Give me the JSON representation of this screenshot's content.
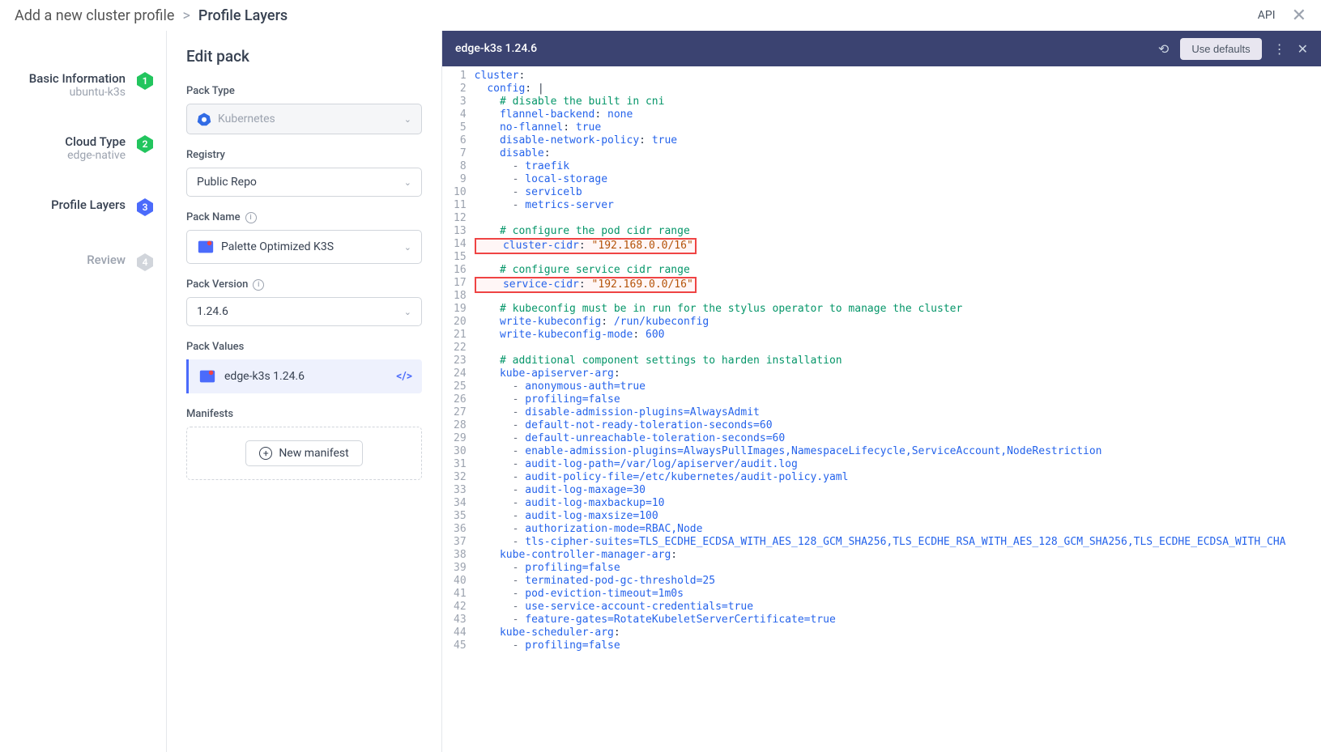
{
  "breadcrumb": {
    "root": "Add a new cluster profile",
    "sep": ">",
    "current": "Profile Layers"
  },
  "topbar": {
    "api": "API"
  },
  "steps": [
    {
      "title": "Basic Information",
      "sub": "ubuntu-k3s",
      "num": "1",
      "color": "#22c55e"
    },
    {
      "title": "Cloud Type",
      "sub": "edge-native",
      "num": "2",
      "color": "#22c55e"
    },
    {
      "title": "Profile Layers",
      "sub": "",
      "num": "3",
      "color": "#4b6bfb"
    },
    {
      "title": "Review",
      "sub": "",
      "num": "4",
      "color": "#d1d5db"
    }
  ],
  "form": {
    "title": "Edit pack",
    "labels": {
      "packType": "Pack Type",
      "registry": "Registry",
      "packName": "Pack Name",
      "packVersion": "Pack Version",
      "packValues": "Pack Values",
      "manifests": "Manifests"
    },
    "values": {
      "packType": "Kubernetes",
      "registry": "Public Repo",
      "packName": "Palette Optimized K3S",
      "packVersion": "1.24.6",
      "packValueItem": "edge-k3s 1.24.6"
    },
    "newManifest": "New manifest"
  },
  "editor": {
    "title": "edge-k3s 1.24.6",
    "defaultsBtn": "Use defaults",
    "lines": [
      [
        {
          "t": "key",
          "v": "cluster"
        },
        {
          "t": "p",
          "v": ":"
        }
      ],
      [
        {
          "t": "p",
          "v": "  "
        },
        {
          "t": "key",
          "v": "config"
        },
        {
          "t": "p",
          "v": ": |"
        }
      ],
      [
        {
          "t": "p",
          "v": "    "
        },
        {
          "t": "comment",
          "v": "# disable the built in cni"
        }
      ],
      [
        {
          "t": "p",
          "v": "    "
        },
        {
          "t": "key",
          "v": "flannel-backend"
        },
        {
          "t": "p",
          "v": ": "
        },
        {
          "t": "key",
          "v": "none"
        }
      ],
      [
        {
          "t": "p",
          "v": "    "
        },
        {
          "t": "key",
          "v": "no-flannel"
        },
        {
          "t": "p",
          "v": ": "
        },
        {
          "t": "key",
          "v": "true"
        }
      ],
      [
        {
          "t": "p",
          "v": "    "
        },
        {
          "t": "key",
          "v": "disable-network-policy"
        },
        {
          "t": "p",
          "v": ": "
        },
        {
          "t": "key",
          "v": "true"
        }
      ],
      [
        {
          "t": "p",
          "v": "    "
        },
        {
          "t": "key",
          "v": "disable"
        },
        {
          "t": "p",
          "v": ":"
        }
      ],
      [
        {
          "t": "p",
          "v": "      "
        },
        {
          "t": "dash",
          "v": "-"
        },
        {
          "t": "p",
          "v": " "
        },
        {
          "t": "key",
          "v": "traefik"
        }
      ],
      [
        {
          "t": "p",
          "v": "      "
        },
        {
          "t": "dash",
          "v": "-"
        },
        {
          "t": "p",
          "v": " "
        },
        {
          "t": "key",
          "v": "local-storage"
        }
      ],
      [
        {
          "t": "p",
          "v": "      "
        },
        {
          "t": "dash",
          "v": "-"
        },
        {
          "t": "p",
          "v": " "
        },
        {
          "t": "key",
          "v": "servicelb"
        }
      ],
      [
        {
          "t": "p",
          "v": "      "
        },
        {
          "t": "dash",
          "v": "-"
        },
        {
          "t": "p",
          "v": " "
        },
        {
          "t": "key",
          "v": "metrics-server"
        }
      ],
      [],
      [
        {
          "t": "p",
          "v": "    "
        },
        {
          "t": "comment",
          "v": "# configure the pod cidr range"
        }
      ],
      [
        {
          "t": "hlstart",
          "v": ""
        },
        {
          "t": "p",
          "v": "    "
        },
        {
          "t": "key",
          "v": "cluster-cidr"
        },
        {
          "t": "p",
          "v": ": "
        },
        {
          "t": "str",
          "v": "\"192.168.0.0/16\""
        },
        {
          "t": "hlend",
          "v": ""
        }
      ],
      [],
      [
        {
          "t": "p",
          "v": "    "
        },
        {
          "t": "comment",
          "v": "# configure service cidr range"
        }
      ],
      [
        {
          "t": "hlstart",
          "v": ""
        },
        {
          "t": "p",
          "v": "    "
        },
        {
          "t": "key",
          "v": "service-cidr"
        },
        {
          "t": "p",
          "v": ": "
        },
        {
          "t": "str",
          "v": "\"192.169.0.0/16\""
        },
        {
          "t": "hlend",
          "v": ""
        }
      ],
      [],
      [
        {
          "t": "p",
          "v": "    "
        },
        {
          "t": "comment",
          "v": "# kubeconfig must be in run for the stylus operator to manage the cluster"
        }
      ],
      [
        {
          "t": "p",
          "v": "    "
        },
        {
          "t": "key",
          "v": "write-kubeconfig"
        },
        {
          "t": "p",
          "v": ": "
        },
        {
          "t": "key",
          "v": "/run/kubeconfig"
        }
      ],
      [
        {
          "t": "p",
          "v": "    "
        },
        {
          "t": "key",
          "v": "write-kubeconfig-mode"
        },
        {
          "t": "p",
          "v": ": "
        },
        {
          "t": "key",
          "v": "600"
        }
      ],
      [],
      [
        {
          "t": "p",
          "v": "    "
        },
        {
          "t": "comment",
          "v": "# additional component settings to harden installation"
        }
      ],
      [
        {
          "t": "p",
          "v": "    "
        },
        {
          "t": "key",
          "v": "kube-apiserver-arg"
        },
        {
          "t": "p",
          "v": ":"
        }
      ],
      [
        {
          "t": "p",
          "v": "      "
        },
        {
          "t": "dash",
          "v": "-"
        },
        {
          "t": "p",
          "v": " "
        },
        {
          "t": "key",
          "v": "anonymous-auth=true"
        }
      ],
      [
        {
          "t": "p",
          "v": "      "
        },
        {
          "t": "dash",
          "v": "-"
        },
        {
          "t": "p",
          "v": " "
        },
        {
          "t": "key",
          "v": "profiling=false"
        }
      ],
      [
        {
          "t": "p",
          "v": "      "
        },
        {
          "t": "dash",
          "v": "-"
        },
        {
          "t": "p",
          "v": " "
        },
        {
          "t": "key",
          "v": "disable-admission-plugins=AlwaysAdmit"
        }
      ],
      [
        {
          "t": "p",
          "v": "      "
        },
        {
          "t": "dash",
          "v": "-"
        },
        {
          "t": "p",
          "v": " "
        },
        {
          "t": "key",
          "v": "default-not-ready-toleration-seconds=60"
        }
      ],
      [
        {
          "t": "p",
          "v": "      "
        },
        {
          "t": "dash",
          "v": "-"
        },
        {
          "t": "p",
          "v": " "
        },
        {
          "t": "key",
          "v": "default-unreachable-toleration-seconds=60"
        }
      ],
      [
        {
          "t": "p",
          "v": "      "
        },
        {
          "t": "dash",
          "v": "-"
        },
        {
          "t": "p",
          "v": " "
        },
        {
          "t": "key",
          "v": "enable-admission-plugins=AlwaysPullImages,NamespaceLifecycle,ServiceAccount,NodeRestriction"
        }
      ],
      [
        {
          "t": "p",
          "v": "      "
        },
        {
          "t": "dash",
          "v": "-"
        },
        {
          "t": "p",
          "v": " "
        },
        {
          "t": "key",
          "v": "audit-log-path=/var/log/apiserver/audit.log"
        }
      ],
      [
        {
          "t": "p",
          "v": "      "
        },
        {
          "t": "dash",
          "v": "-"
        },
        {
          "t": "p",
          "v": " "
        },
        {
          "t": "key",
          "v": "audit-policy-file=/etc/kubernetes/audit-policy.yaml"
        }
      ],
      [
        {
          "t": "p",
          "v": "      "
        },
        {
          "t": "dash",
          "v": "-"
        },
        {
          "t": "p",
          "v": " "
        },
        {
          "t": "key",
          "v": "audit-log-maxage=30"
        }
      ],
      [
        {
          "t": "p",
          "v": "      "
        },
        {
          "t": "dash",
          "v": "-"
        },
        {
          "t": "p",
          "v": " "
        },
        {
          "t": "key",
          "v": "audit-log-maxbackup=10"
        }
      ],
      [
        {
          "t": "p",
          "v": "      "
        },
        {
          "t": "dash",
          "v": "-"
        },
        {
          "t": "p",
          "v": " "
        },
        {
          "t": "key",
          "v": "audit-log-maxsize=100"
        }
      ],
      [
        {
          "t": "p",
          "v": "      "
        },
        {
          "t": "dash",
          "v": "-"
        },
        {
          "t": "p",
          "v": " "
        },
        {
          "t": "key",
          "v": "authorization-mode=RBAC,Node"
        }
      ],
      [
        {
          "t": "p",
          "v": "      "
        },
        {
          "t": "dash",
          "v": "-"
        },
        {
          "t": "p",
          "v": " "
        },
        {
          "t": "key",
          "v": "tls-cipher-suites=TLS_ECDHE_ECDSA_WITH_AES_128_GCM_SHA256,TLS_ECDHE_RSA_WITH_AES_128_GCM_SHA256,TLS_ECDHE_ECDSA_WITH_CHA"
        }
      ],
      [
        {
          "t": "p",
          "v": "    "
        },
        {
          "t": "key",
          "v": "kube-controller-manager-arg"
        },
        {
          "t": "p",
          "v": ":"
        }
      ],
      [
        {
          "t": "p",
          "v": "      "
        },
        {
          "t": "dash",
          "v": "-"
        },
        {
          "t": "p",
          "v": " "
        },
        {
          "t": "key",
          "v": "profiling=false"
        }
      ],
      [
        {
          "t": "p",
          "v": "      "
        },
        {
          "t": "dash",
          "v": "-"
        },
        {
          "t": "p",
          "v": " "
        },
        {
          "t": "key",
          "v": "terminated-pod-gc-threshold=25"
        }
      ],
      [
        {
          "t": "p",
          "v": "      "
        },
        {
          "t": "dash",
          "v": "-"
        },
        {
          "t": "p",
          "v": " "
        },
        {
          "t": "key",
          "v": "pod-eviction-timeout=1m0s"
        }
      ],
      [
        {
          "t": "p",
          "v": "      "
        },
        {
          "t": "dash",
          "v": "-"
        },
        {
          "t": "p",
          "v": " "
        },
        {
          "t": "key",
          "v": "use-service-account-credentials=true"
        }
      ],
      [
        {
          "t": "p",
          "v": "      "
        },
        {
          "t": "dash",
          "v": "-"
        },
        {
          "t": "p",
          "v": " "
        },
        {
          "t": "key",
          "v": "feature-gates=RotateKubeletServerCertificate=true"
        }
      ],
      [
        {
          "t": "p",
          "v": "    "
        },
        {
          "t": "key",
          "v": "kube-scheduler-arg"
        },
        {
          "t": "p",
          "v": ":"
        }
      ],
      [
        {
          "t": "p",
          "v": "      "
        },
        {
          "t": "dash",
          "v": "-"
        },
        {
          "t": "p",
          "v": " "
        },
        {
          "t": "key",
          "v": "profiling=false"
        }
      ]
    ]
  }
}
